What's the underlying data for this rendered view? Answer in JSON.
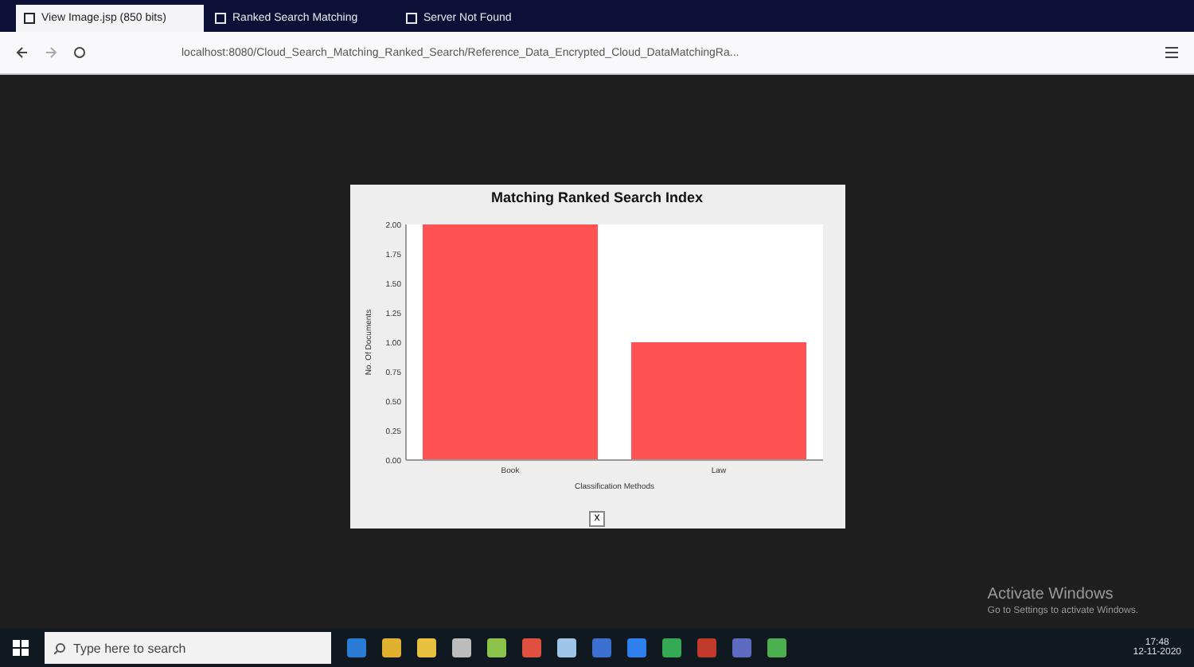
{
  "browser": {
    "tabs": [
      {
        "label": "View Image.jsp (850 bits)",
        "selected": true
      },
      {
        "label": "Ranked Search Matching",
        "selected": false
      },
      {
        "label": "Server Not Found",
        "selected": false
      }
    ],
    "url": "localhost:8080/Cloud_Search_Matching_Ranked_Search/Reference_Data_Encrypted_Cloud_DataMatchingRa..."
  },
  "chart_panel": {
    "chart_data": {
      "type": "bar",
      "title": "Matching Ranked Search Index",
      "xlabel": "Classification Methods",
      "ylabel": "No. Of Documents",
      "categories": [
        "Book",
        "Law"
      ],
      "series": [
        {
          "color": "#ff5252",
          "values": [
            2.0,
            1.0
          ]
        }
      ],
      "ylim": [
        0,
        2
      ],
      "yticks": [
        {
          "value": 0,
          "label": "0.00"
        },
        {
          "value": 0.25,
          "label": "0.25"
        },
        {
          "value": 0.5,
          "label": "0.50"
        },
        {
          "value": 0.75,
          "label": "0.75"
        },
        {
          "value": 1,
          "label": "1.00"
        },
        {
          "value": 1.25,
          "label": "1.25"
        },
        {
          "value": 1.5,
          "label": "1.50"
        },
        {
          "value": 1.75,
          "label": "1.75"
        },
        {
          "value": 2,
          "label": "2.00"
        }
      ]
    },
    "close_label": "x"
  },
  "watermark": {
    "title": "Activate Windows",
    "subtitle": "Go to Settings to activate Windows."
  },
  "taskbar": {
    "search_placeholder": "Type here to search",
    "time": "17:48",
    "date": "12-11-2020"
  }
}
